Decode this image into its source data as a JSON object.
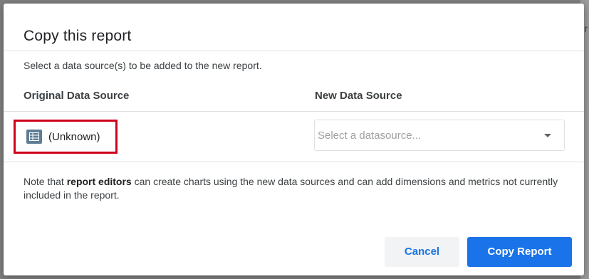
{
  "dialog": {
    "title": "Copy this report",
    "subtitle": "Select a data source(s) to be added to the new report.",
    "columns": {
      "original": "Original Data Source",
      "new": "New Data Source"
    },
    "original_source": {
      "label": "(Unknown)",
      "icon": "table-icon"
    },
    "new_source": {
      "placeholder": "Select a datasource...",
      "icon": "chevron-down-icon"
    },
    "note": {
      "prefix": "Note that ",
      "bold": "report editors",
      "suffix": " can create charts using the new data sources and can add dimensions and metrics not currently included in the report."
    },
    "buttons": {
      "cancel": "Cancel",
      "copy": "Copy Report"
    }
  },
  "background": {
    "glyph": "r"
  },
  "colors": {
    "accent": "#1a73e8",
    "highlight_border": "#d0021b",
    "icon_bg": "#5f7d95"
  }
}
